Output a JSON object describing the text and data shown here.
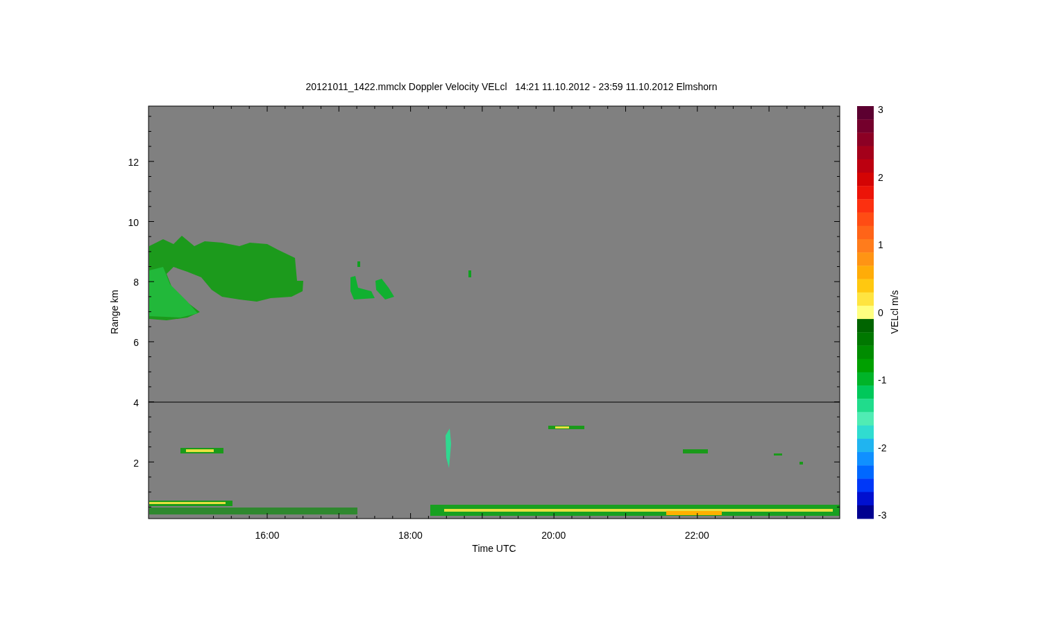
{
  "title": "20121011_1422.mmclx Doppler Velocity VELcl   14:21 11.10.2012 - 23:59 11.10.2012 Elmshorn",
  "plot": {
    "xlabel": "Time UTC",
    "ylabel": "Range km",
    "xticks": [
      "16:00",
      "18:00",
      "20:00",
      "22:00"
    ],
    "yticks": [
      "12",
      "10",
      "8",
      "6",
      "4",
      "2"
    ]
  },
  "colorbar": {
    "label": "VELcl m/s",
    "ticks": [
      "3",
      "2",
      "1",
      "0",
      "-1",
      "-2",
      "-3"
    ],
    "segments": [
      {
        "color": "#5c0030"
      },
      {
        "color": "#74002c"
      },
      {
        "color": "#8c0024"
      },
      {
        "color": "#a4001a"
      },
      {
        "color": "#bc0010"
      },
      {
        "color": "#d40404"
      },
      {
        "color": "#ec1408"
      },
      {
        "color": "#fc3010"
      },
      {
        "color": "#ff4c14"
      },
      {
        "color": "#ff6418"
      },
      {
        "color": "#ff7c1c"
      },
      {
        "color": "#ff9414"
      },
      {
        "color": "#ffac08"
      },
      {
        "color": "#ffc810"
      },
      {
        "color": "#ffe440"
      },
      {
        "color": "#ffff80"
      },
      {
        "color": "#006400"
      },
      {
        "color": "#007800"
      },
      {
        "color": "#008c00"
      },
      {
        "color": "#00a000"
      },
      {
        "color": "#00b428"
      },
      {
        "color": "#00c85a"
      },
      {
        "color": "#20dc8c"
      },
      {
        "color": "#50ecb4"
      },
      {
        "color": "#30dcd0"
      },
      {
        "color": "#20b4f0"
      },
      {
        "color": "#1090ff"
      },
      {
        "color": "#0068ff"
      },
      {
        "color": "#0038f8"
      },
      {
        "color": "#0010d0"
      },
      {
        "color": "#000090"
      }
    ]
  }
}
